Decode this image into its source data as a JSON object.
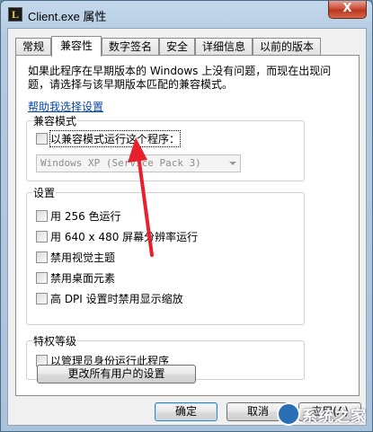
{
  "window": {
    "title": "Client.exe 属性",
    "icon_letter": "L",
    "close_label": "X"
  },
  "tabs": [
    {
      "label": "常规"
    },
    {
      "label": "兼容性",
      "active": true
    },
    {
      "label": "数字签名"
    },
    {
      "label": "安全"
    },
    {
      "label": "详细信息"
    },
    {
      "label": "以前的版本"
    }
  ],
  "intro_text": "如果此程序在早期版本的 Windows 上没有问题，而现在出现问题，请选择与该早期版本匹配的兼容模式。",
  "help_link": "帮助我选择设置",
  "compat_mode": {
    "group_title": "兼容模式",
    "checkbox_label": "以兼容模式运行这个程序：",
    "checked": false,
    "selected_os": "Windows XP (Service Pack 3)"
  },
  "settings": {
    "group_title": "设置",
    "items": [
      {
        "label": "用 256 色运行",
        "checked": false
      },
      {
        "label": "用 640 x 480 屏幕分辨率运行",
        "checked": false
      },
      {
        "label": "禁用视觉主题",
        "checked": false
      },
      {
        "label": "禁用桌面元素",
        "checked": false
      },
      {
        "label": "高 DPI 设置时禁用显示缩放",
        "checked": false
      }
    ]
  },
  "privilege": {
    "group_title": "特权等级",
    "checkbox_label": "以管理员身份运行此程序",
    "checked": false
  },
  "change_all_button": "更改所有用户的设置",
  "footer": {
    "ok": "确定",
    "cancel": "取消",
    "apply": "应用(A)"
  },
  "colors": {
    "annotation_arrow": "#e8202c",
    "link": "#0645ad"
  },
  "watermark_text": "系统之家"
}
